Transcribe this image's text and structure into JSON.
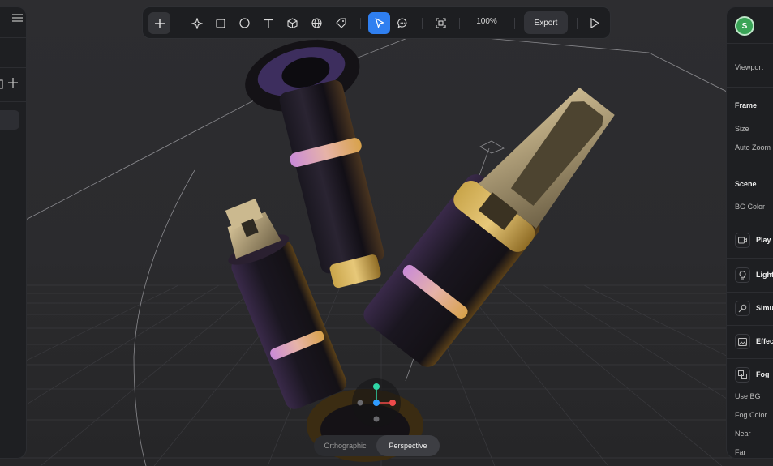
{
  "toolbar": {
    "zoom": "100%",
    "export_label": "Export"
  },
  "right_panel": {
    "avatar_initial": "S",
    "viewport_label": "Viewport",
    "frame_header": "Frame",
    "size_label": "Size",
    "auto_zoom_label": "Auto Zoom",
    "scene_header": "Scene",
    "bg_color_label": "BG Color",
    "play_label": "Play C",
    "light_label": "Light",
    "simu_label": "Simu",
    "effects_label": "Effec",
    "fog_label": "Fog",
    "use_bg_label": "Use BG",
    "fog_color_label": "Fog Color",
    "near_label": "Near",
    "far_label": "Far"
  },
  "view_toggle": {
    "orthographic_label": "Orthographic",
    "perspective_label": "Perspective",
    "active": "Perspective"
  },
  "icons": {
    "add": "plus-icon",
    "ai": "sparkle-icon",
    "rect": "square-icon",
    "circle": "circle-icon",
    "text": "text-icon",
    "cube": "cube-icon",
    "globe": "globe-icon",
    "tag": "tag-icon",
    "select": "pointer-icon",
    "comment": "comment-icon",
    "fit": "frame-icon",
    "play": "play-icon"
  },
  "colors": {
    "accent": "#2f7ff0",
    "avatar": "#3aa457",
    "gizmo_x": "#ef4a4a",
    "gizmo_y": "#2fd6a6",
    "gizmo_z": "#2f9bff"
  }
}
